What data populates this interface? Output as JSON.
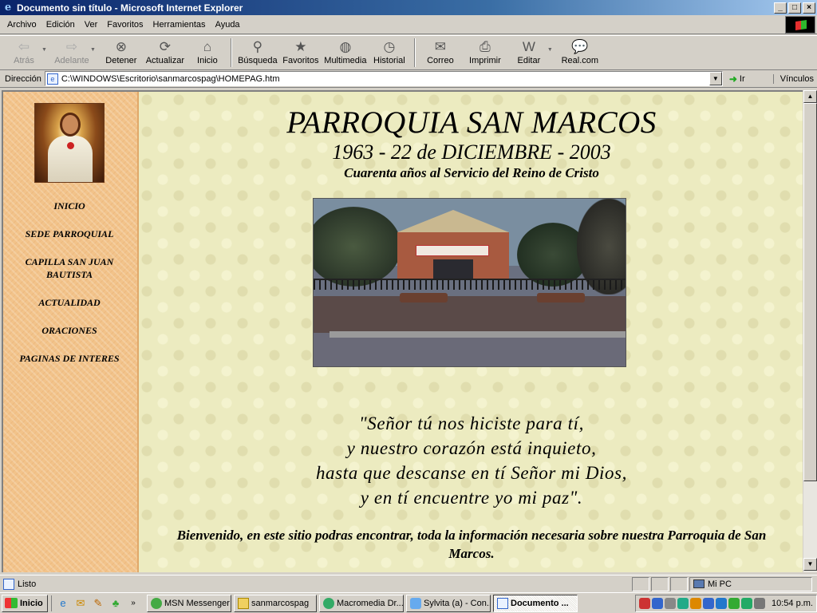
{
  "window": {
    "title": "Documento sin título - Microsoft Internet Explorer",
    "minimize": "_",
    "maximize": "□",
    "close": "×"
  },
  "menu": [
    "Archivo",
    "Edición",
    "Ver",
    "Favoritos",
    "Herramientas",
    "Ayuda"
  ],
  "toolbar": {
    "back": "Atrás",
    "forward": "Adelante",
    "stop": "Detener",
    "refresh": "Actualizar",
    "home": "Inicio",
    "search": "Búsqueda",
    "favorites": "Favoritos",
    "media": "Multimedia",
    "history": "Historial",
    "mail": "Correo",
    "print": "Imprimir",
    "edit": "Editar",
    "real": "Real.com"
  },
  "address": {
    "label": "Dirección",
    "value": "C:\\WINDOWS\\Escritorio\\sanmarcospag\\HOMEPAG.htm",
    "go": "Ir",
    "links": "Vínculos"
  },
  "page": {
    "nav": [
      "INICIO",
      "SEDE PARROQUIAL",
      "CAPILLA SAN JUAN BAUTISTA",
      "ACTUALIDAD",
      "ORACIONES",
      "PAGINAS DE INTERES"
    ],
    "title": "PARROQUIA SAN MARCOS",
    "dates": "1963 - 22 de DICIEMBRE - 2003",
    "subtitle": "Cuarenta años al Servicio del Reino de Cristo",
    "quote": [
      "\"Señor tú nos hiciste para tí,",
      "y nuestro corazón está inquieto,",
      "hasta que descanse en tí Señor mi Dios,",
      "y en tí encuentre yo mi paz\"."
    ],
    "welcome": "Bienvenido, en este sitio podras encontrar, toda la información necesaria sobre nuestra Parroquia de San Marcos."
  },
  "status": {
    "text": "Listo",
    "zone": "Mi PC"
  },
  "taskbar": {
    "start": "Inicio",
    "tasks": [
      "MSN Messenger",
      "sanmarcospag",
      "Macromedia Dr...",
      "Sylvita (a) - Con...",
      "Documento ..."
    ],
    "clock": "10:54 p.m."
  }
}
